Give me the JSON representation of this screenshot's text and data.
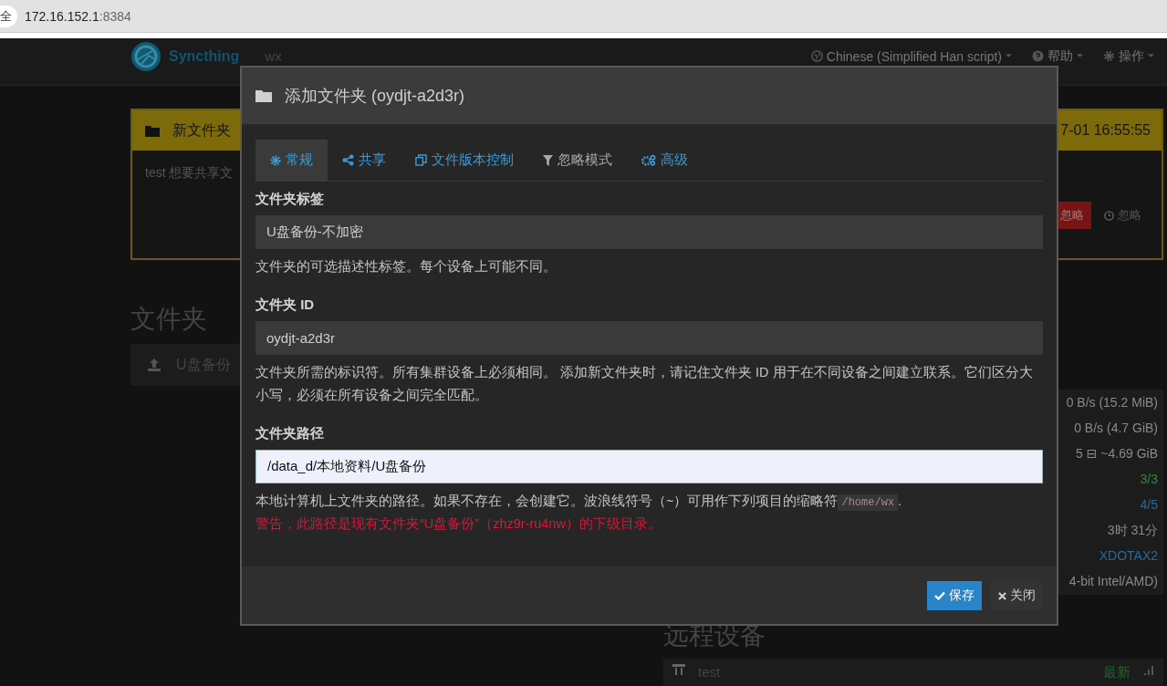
{
  "browser": {
    "security_badge": "全",
    "address_host": "172.16.152.1",
    "address_port": ":8384"
  },
  "navbar": {
    "brand": "Syncthing",
    "device_name": "wx",
    "menus": [
      {
        "kind": "language",
        "label": "Chinese (Simplified Han script)"
      },
      {
        "kind": "help",
        "label": "帮助"
      },
      {
        "kind": "actions",
        "label": "操作"
      }
    ]
  },
  "background": {
    "notice": {
      "title": "新文件夹",
      "time": "7-01 16:55:55",
      "message": "test 想要共享文",
      "buttons": [
        {
          "kind": "danger",
          "label": "忽略"
        },
        {
          "kind": "plain",
          "label": "忽略"
        }
      ]
    },
    "folders_heading": "文件夹",
    "folder_row": "U盘备份",
    "stats": [
      {
        "text": "0 B/s (15.2 MiB)",
        "color": "#8a8a8a"
      },
      {
        "text": "0 B/s (4.7 GiB)",
        "color": "#8a8a8a"
      },
      {
        "text": "5  ⊟ ~4.69 GiB",
        "color": "#8a8a8a"
      },
      {
        "text": "3/3",
        "color": "#2e8b3a"
      },
      {
        "text": "4/5",
        "color": "#2a6a9a"
      },
      {
        "text": "3时 31分",
        "color": "#8a8a8a"
      },
      {
        "text": "XDOTAX2",
        "color": "#2a6a9a"
      },
      {
        "text": "4-bit Intel/AMD)",
        "color": "#8a8a8a"
      }
    ],
    "devices_heading": "远程设备",
    "device_row": {
      "name": "test",
      "status": "最新"
    }
  },
  "dialog": {
    "title": "添加文件夹 (oydjt-a2d3r)",
    "tabs": [
      {
        "kind": "general",
        "label": "常规",
        "selected": true,
        "disabled": false
      },
      {
        "kind": "sharing",
        "label": "共享",
        "selected": false,
        "disabled": false
      },
      {
        "kind": "versioning",
        "label": "文件版本控制",
        "selected": false,
        "disabled": false
      },
      {
        "kind": "ignore",
        "label": "忽略模式",
        "selected": false,
        "disabled": true
      },
      {
        "kind": "advanced",
        "label": "高级",
        "selected": false,
        "disabled": false
      }
    ],
    "fields": [
      {
        "label": "文件夹标签",
        "value": "U盘备份-不加密",
        "focused": false,
        "help": "文件夹的可选描述性标签。每个设备上可能不同。"
      },
      {
        "label": "文件夹 ID",
        "value": "oydjt-a2d3r",
        "focused": false,
        "help": "文件夹所需的标识符。所有集群设备上必须相同。 添加新文件夹时，请记住文件夹 ID 用于在不同设备之间建立联系。它们区分大小写，必须在所有设备之间完全匹配。"
      },
      {
        "label": "文件夹路径",
        "value": "/data_d/本地资料/U盘备份",
        "focused": true,
        "help": "本地计算机上文件夹的路径。如果不存在，会创建它。波浪线符号（~）可用作下列项目的缩略符",
        "help_code": "/home/wx",
        "help_tail": ".",
        "warning": "警告，此路径是现有文件夹“U盘备份”（zhz9r-ru4nw）的下级目录。"
      }
    ],
    "buttons": [
      {
        "kind": "primary",
        "label": "保存"
      },
      {
        "kind": "close",
        "label": "关闭"
      }
    ]
  }
}
